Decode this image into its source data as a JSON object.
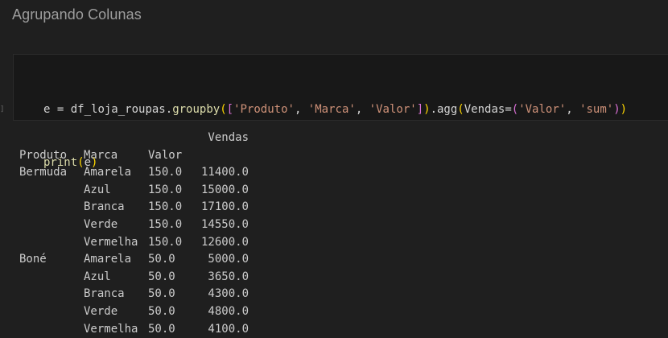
{
  "heading": "Agrupando Colunas",
  "cell": {
    "execution_count": "]",
    "code_tokens_line1": [
      {
        "t": "e",
        "c": "t-var"
      },
      {
        "t": " = ",
        "c": "t-op"
      },
      {
        "t": "df_loja_roupas",
        "c": "t-var"
      },
      {
        "t": ".",
        "c": "t-punct"
      },
      {
        "t": "groupby",
        "c": "t-fn"
      },
      {
        "t": "(",
        "c": "t-b1"
      },
      {
        "t": "[",
        "c": "t-b2"
      },
      {
        "t": "'Produto'",
        "c": "t-str"
      },
      {
        "t": ", ",
        "c": "t-punct"
      },
      {
        "t": "'Marca'",
        "c": "t-str"
      },
      {
        "t": ", ",
        "c": "t-punct"
      },
      {
        "t": "'Valor'",
        "c": "t-str"
      },
      {
        "t": "]",
        "c": "t-b2"
      },
      {
        "t": ")",
        "c": "t-b1"
      },
      {
        "t": ".",
        "c": "t-punct"
      },
      {
        "t": "agg",
        "c": "t-var"
      },
      {
        "t": "(",
        "c": "t-b1"
      },
      {
        "t": "Vendas",
        "c": "t-var"
      },
      {
        "t": "=",
        "c": "t-op"
      },
      {
        "t": "(",
        "c": "t-b2"
      },
      {
        "t": "'Valor'",
        "c": "t-str"
      },
      {
        "t": ", ",
        "c": "t-punct"
      },
      {
        "t": "'sum'",
        "c": "t-str"
      },
      {
        "t": ")",
        "c": "t-b2"
      },
      {
        "t": ")",
        "c": "t-b1"
      }
    ],
    "code_tokens_line2": [
      {
        "t": "print",
        "c": "t-fn"
      },
      {
        "t": "(",
        "c": "t-b1"
      },
      {
        "t": "e",
        "c": "t-var"
      },
      {
        "t": ")",
        "c": "t-b1"
      }
    ]
  },
  "output": {
    "value_header": "Vendas",
    "index_headers": [
      "Produto",
      "Marca",
      "Valor"
    ],
    "rows": [
      {
        "produto": "Bermuda",
        "marca": "Amarela",
        "valor": "150.0",
        "vendas": "11400.0"
      },
      {
        "produto": "",
        "marca": "Azul",
        "valor": "150.0",
        "vendas": "15000.0"
      },
      {
        "produto": "",
        "marca": "Branca",
        "valor": "150.0",
        "vendas": "17100.0"
      },
      {
        "produto": "",
        "marca": "Verde",
        "valor": "150.0",
        "vendas": "14550.0"
      },
      {
        "produto": "",
        "marca": "Vermelha",
        "valor": "150.0",
        "vendas": "12600.0"
      },
      {
        "produto": "Boné",
        "marca": "Amarela",
        "valor": "50.0",
        "vendas": "5000.0"
      },
      {
        "produto": "",
        "marca": "Azul",
        "valor": "50.0",
        "vendas": "3650.0"
      },
      {
        "produto": "",
        "marca": "Branca",
        "valor": "50.0",
        "vendas": "4300.0"
      },
      {
        "produto": "",
        "marca": "Verde",
        "valor": "50.0",
        "vendas": "4800.0"
      },
      {
        "produto": "",
        "marca": "Vermelha",
        "valor": "50.0",
        "vendas": "4100.0"
      }
    ]
  }
}
